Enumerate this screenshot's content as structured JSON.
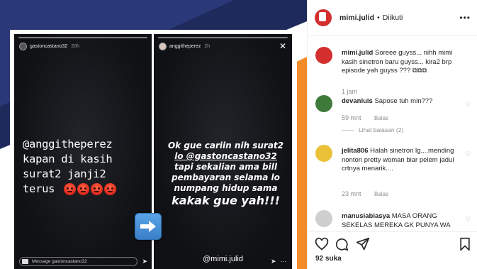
{
  "story_left": {
    "username": "gastoncastano32",
    "time": "20h",
    "text_lines": [
      "@anggitheperez",
      "kapan di kasih",
      "surat2 janji2",
      "terus"
    ],
    "emoji_count": 4,
    "reply_placeholder": "Message gastoncastano32"
  },
  "story_right": {
    "username": "anggitheperez",
    "time": "2h",
    "lines": [
      "Ok gue cariin nih surat2",
      "lo @gastoncastano32",
      "tapi sekalian ama bill",
      "pembayaran selama lo",
      "numpang hidup sama",
      "kakak gue yah!!!"
    ],
    "mention": "@mimi.julid"
  },
  "post": {
    "author": "mimi.julid",
    "follow_status": "Diikuti",
    "caption": "Soreee guyss... nihh mimi kasih sinetron baru guyss... kira2 brp episode yah guyss ??? ⧉⧉⧉",
    "caption_time": "1 jam",
    "likes": "92 suka"
  },
  "comments": [
    {
      "user": "devanluis",
      "text": "Sapose tuh min???",
      "time": "59 mnt",
      "reply_label": "Balas",
      "view_replies": "Lihat balasan (2)"
    },
    {
      "user": "jelita806",
      "text": "Halah sinetron lg....mending nonton pretty woman biar pelem jadul crtnya menarik....",
      "time": "23 mnt",
      "reply_label": "Balas"
    },
    {
      "user": "manusiabiasya",
      "text": "MASA ORANG SEKELAS MEREKA GK PUNYA WA"
    }
  ],
  "colors": {
    "accent_navy": "#1f2a5c",
    "accent_orange": "#f28c28",
    "accent_blue": "#3b4fc4"
  },
  "icons": [
    "heart-icon",
    "comment-icon",
    "share-icon",
    "bookmark-icon",
    "arrow-right-icon",
    "close-icon",
    "camera-icon",
    "send-icon",
    "more-icon"
  ]
}
